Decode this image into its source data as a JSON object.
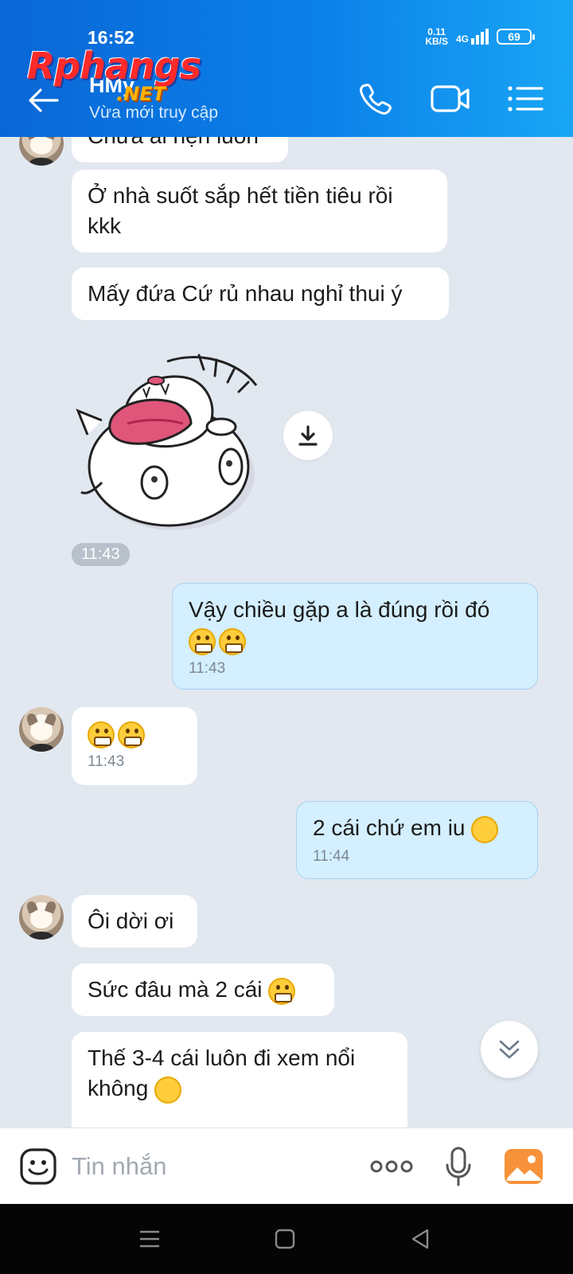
{
  "status_bar": {
    "time": "16:52",
    "net_speed_value": "0.11",
    "net_speed_unit": "KB/S",
    "network": "4G",
    "battery": "69"
  },
  "header": {
    "contact_name": "HMy",
    "contact_status": "Vừa mới truy cập",
    "watermark_main": "Rphangs",
    "watermark_sub": ".NET",
    "icons": [
      "back-arrow-icon",
      "phone-icon",
      "video-call-icon",
      "menu-list-icon"
    ]
  },
  "messages": [
    {
      "side": "in",
      "text": "Chưa ai hẹn luôn",
      "partial": true
    },
    {
      "side": "in",
      "text": "Ở nhà suốt sắp hết tiền tiêu rồi kkk"
    },
    {
      "side": "in",
      "text": "Mấy đứa Cứ rủ nhau nghỉ thui ý"
    },
    {
      "side": "in",
      "type": "sticker",
      "time": "11:43"
    },
    {
      "side": "out",
      "text": "Vậy chiều gặp a là đúng rồi đó",
      "emojis": "😁😁",
      "time": "11:43"
    },
    {
      "side": "in",
      "emojis": "😬😬",
      "time": "11:43"
    },
    {
      "side": "out",
      "text": "2 cái chứ em iu",
      "emojis": "🤭",
      "time": "11:44"
    },
    {
      "side": "in",
      "text": "Ôi dời ơi"
    },
    {
      "side": "in",
      "text": "Sức đâu mà 2 cái",
      "emojis": "😬"
    },
    {
      "side": "in",
      "text": "Thế 3-4 cái luôn đi xem nổi không",
      "emojis": "😅",
      "partial": true
    }
  ],
  "input": {
    "placeholder": "Tin nhắn"
  },
  "colors": {
    "header_start": "#0a67d6",
    "header_end": "#19a6f5",
    "chat_bg": "#e2e8f0",
    "incoming_bubble": "#ffffff",
    "outgoing_bubble": "#d4efff"
  }
}
